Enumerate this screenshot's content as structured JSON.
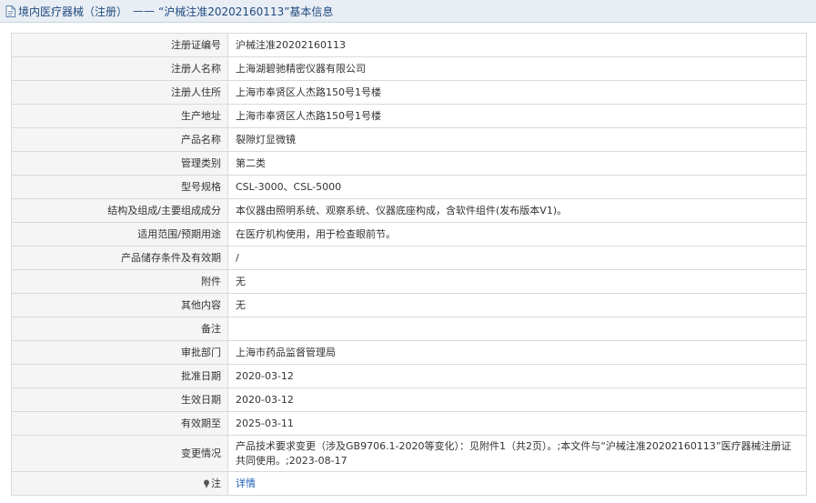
{
  "header": {
    "category": "境内医疗器械（注册）",
    "separator": "——",
    "title": "“沪械注准20202160113”基本信息",
    "icon": "document-icon"
  },
  "rows": [
    {
      "key": "reg_no",
      "label": "注册证编号",
      "value": "沪械注准20202160113"
    },
    {
      "key": "registrant",
      "label": "注册人名称",
      "value": "上海湖碧驰精密仪器有限公司"
    },
    {
      "key": "registrant_addr",
      "label": "注册人住所",
      "value": "上海市奉贤区人杰路150号1号楼"
    },
    {
      "key": "production_addr",
      "label": "生产地址",
      "value": "上海市奉贤区人杰路150号1号楼"
    },
    {
      "key": "product_name",
      "label": "产品名称",
      "value": "裂隙灯显微镜"
    },
    {
      "key": "class",
      "label": "管理类别",
      "value": "第二类"
    },
    {
      "key": "model",
      "label": "型号规格",
      "value": "CSL-3000、CSL-5000"
    },
    {
      "key": "structure",
      "label": "结构及组成/主要组成成分",
      "value": "本仪器由照明系统、观察系统、仪器底座构成，含软件组件(发布版本V1)。"
    },
    {
      "key": "scope",
      "label": "适用范围/预期用途",
      "value": "在医疗机构使用，用于检查眼前节。"
    },
    {
      "key": "storage",
      "label": "产品储存条件及有效期",
      "value": "/"
    },
    {
      "key": "attachment",
      "label": "附件",
      "value": "无"
    },
    {
      "key": "other",
      "label": "其他内容",
      "value": "无"
    },
    {
      "key": "remark",
      "label": "备注",
      "value": ""
    },
    {
      "key": "approval_dept",
      "label": "审批部门",
      "value": "上海市药品监督管理局"
    },
    {
      "key": "approval_date",
      "label": "批准日期",
      "value": "2020-03-12"
    },
    {
      "key": "effective_date",
      "label": "生效日期",
      "value": "2020-03-12"
    },
    {
      "key": "expiry_date",
      "label": "有效期至",
      "value": "2025-03-11"
    },
    {
      "key": "changes",
      "label": "变更情况",
      "value": "产品技术要求变更（涉及GB9706.1-2020等变化）：见附件1（共2页）。;本文件与“沪械注准20202160113”医疗器械注册证共同使用。;2023-08-17"
    }
  ],
  "note_row": {
    "label": "注",
    "icon": "pin-icon",
    "link_text": "详情"
  }
}
